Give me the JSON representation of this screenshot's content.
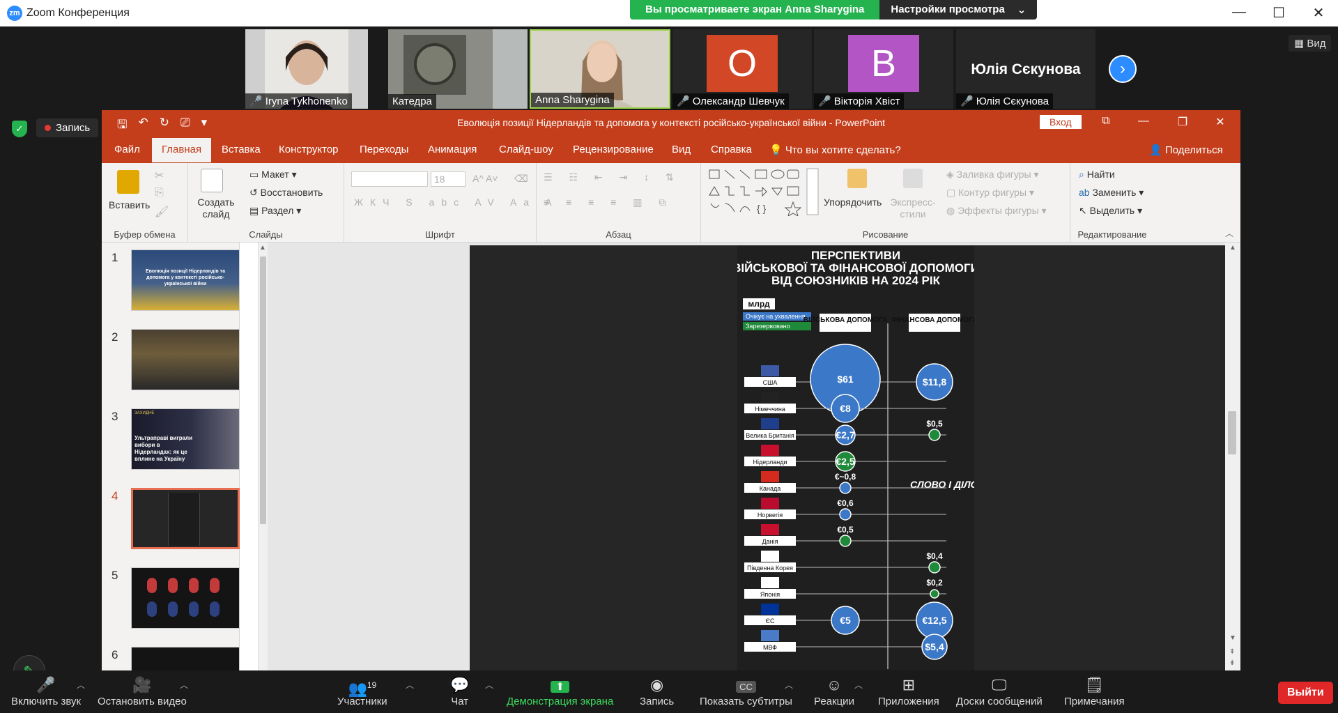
{
  "zoom": {
    "window_title": "Zoom Конференция",
    "share_banner": "Вы просматриваете экран Anna Sharygina",
    "view_settings": "Настройки просмотра",
    "view_button": "Вид",
    "record_label": "Запись",
    "participants": [
      {
        "name": "Iryna Tykhonenko",
        "muted": true,
        "type": "video"
      },
      {
        "name": "Катедра",
        "muted": false,
        "type": "video"
      },
      {
        "name": "Anna Sharygina",
        "muted": false,
        "type": "video"
      },
      {
        "name": "Олександр Шевчук",
        "muted": true,
        "type": "avatar",
        "initial": "O",
        "color": "#d24726"
      },
      {
        "name": "Вікторія Хвіст",
        "muted": true,
        "type": "avatar",
        "initial": "B",
        "color": "#b455c6"
      },
      {
        "name": "Юлія Сєкунова",
        "muted": true,
        "type": "text",
        "big": "Юлія Сєкунова"
      }
    ]
  },
  "ppt": {
    "title": "Еволюція позиції Нідерландів та допомога у контексті російсько-української війни  -  PowerPoint",
    "login": "Вход",
    "tabs": [
      "Файл",
      "Главная",
      "Вставка",
      "Конструктор",
      "Переходы",
      "Анимация",
      "Слайд-шоу",
      "Рецензирование",
      "Вид",
      "Справка"
    ],
    "tell_me": "Что вы хотите сделать?",
    "share": "Поделиться",
    "ribbon": {
      "paste": "Вставить",
      "clipboard": "Буфер обмена",
      "new_slide": "Создать слайд",
      "layout": "Макет",
      "reset": "Восстановить",
      "section": "Раздел",
      "slides": "Слайды",
      "font_size": "18",
      "font": "Шрифт",
      "paragraph": "Абзац",
      "arrange": "Упорядочить",
      "quick_styles": "Экспресс-стили",
      "shape_fill": "Заливка фигуры",
      "shape_outline": "Контур фигуры",
      "shape_effects": "Эффекты фигуры",
      "drawing": "Рисование",
      "find": "Найти",
      "replace": "Заменить",
      "select": "Выделить",
      "editing": "Редактирование"
    },
    "thumbnails": [
      {
        "num": "1",
        "text": "Еволюція позиції Нідерландів та допомога у контексті російсько-української війни"
      },
      {
        "num": "2",
        "text": ""
      },
      {
        "num": "3",
        "text": "Ультраправі виграли вибори в Нідерландах: як це вплине на Україну",
        "brand": "ЗАХИДНЕ"
      },
      {
        "num": "4",
        "text": ""
      },
      {
        "num": "5",
        "text": ""
      },
      {
        "num": "6",
        "text": ""
      }
    ]
  },
  "infographic": {
    "title_line1": "ПЕРСПЕКТИВИ",
    "title_line2": "ВІЙСЬКОВОЇ ТА ФІНАНСОВОЇ ДОПОМОГИ",
    "title_line3": "ВІД СОЮЗНИКІВ НА 2024 РІК",
    "unit": "млрд",
    "legend_pending": "Очікує на ухвалення",
    "legend_reserved": "Зарезервовано",
    "col_military": "ВІЙСЬКОВА ДОПОМОГА",
    "col_financial": "ФІНАНСОВА ДОПОМОГА",
    "brand": "СЛОВО І ДІЛО",
    "rows": [
      {
        "country": "США",
        "military": "$61",
        "financial": "$11,8"
      },
      {
        "country": "Німеччина",
        "military": "€8",
        "financial": ""
      },
      {
        "country": "Велика Британія",
        "military": "€2,7",
        "financial": "$0,5"
      },
      {
        "country": "Нідерланди",
        "military": "€2,5",
        "financial": ""
      },
      {
        "country": "Канада",
        "military": "€~0,8",
        "financial": ""
      },
      {
        "country": "Норвегія",
        "military": "€0,6",
        "financial": ""
      },
      {
        "country": "Данія",
        "military": "€0,5",
        "financial": ""
      },
      {
        "country": "Південна Корея",
        "military": "",
        "financial": "$0,4"
      },
      {
        "country": "Японія",
        "military": "",
        "financial": "$0,2"
      },
      {
        "country": "ЄС",
        "military": "€5",
        "financial": "€12,5"
      },
      {
        "country": "МВФ",
        "military": "",
        "financial": "$5,4"
      }
    ]
  },
  "toolbar": {
    "unmute": "Включить звук",
    "stop_video": "Остановить видео",
    "participants": "Участники",
    "participants_count": "19",
    "chat": "Чат",
    "share": "Демонстрация экрана",
    "record": "Запись",
    "captions": "Показать субтитры",
    "reactions": "Реакции",
    "apps": "Приложения",
    "whiteboards": "Доски сообщений",
    "notes": "Примечания",
    "leave": "Выйти"
  }
}
